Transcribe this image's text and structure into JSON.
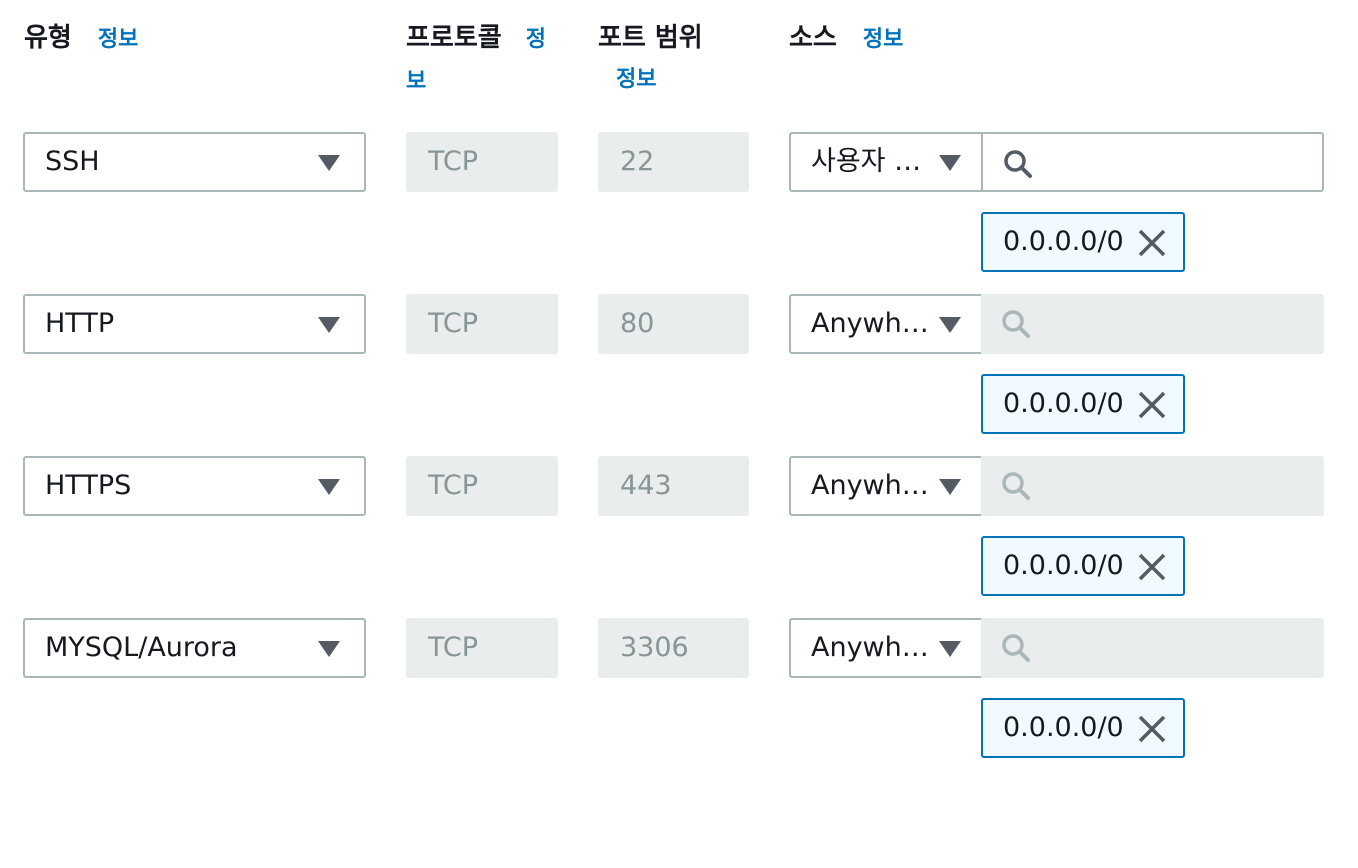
{
  "headers": {
    "type": "유형",
    "type_info": "정보",
    "protocol": "프로토콜",
    "protocol_info_1": "정",
    "protocol_info_2": "보",
    "port_range": "포트 범위",
    "port_info": "정보",
    "source": "소스",
    "source_info": "정보"
  },
  "rules": [
    {
      "type": "SSH",
      "protocol": "TCP",
      "port": "22",
      "source": "사용자 …",
      "token": "0.0.0.0/0",
      "search_active": true
    },
    {
      "type": "HTTP",
      "protocol": "TCP",
      "port": "80",
      "source": "Anywh…",
      "token": "0.0.0.0/0",
      "search_active": false
    },
    {
      "type": "HTTPS",
      "protocol": "TCP",
      "port": "443",
      "source": "Anywh…",
      "token": "0.0.0.0/0",
      "search_active": false
    },
    {
      "type": "MYSQL/Aurora",
      "protocol": "TCP",
      "port": "3306",
      "source": "Anywh…",
      "token": "0.0.0.0/0",
      "search_active": false
    }
  ],
  "icons": {
    "dropdown": "caret-down-icon",
    "search": "search-icon",
    "remove": "close-icon"
  },
  "colors": {
    "link": "#0073bb",
    "token_border": "#0073bb",
    "token_bg": "#f1faff",
    "disabled_bg": "#eaeded",
    "disabled_text": "#879596"
  }
}
